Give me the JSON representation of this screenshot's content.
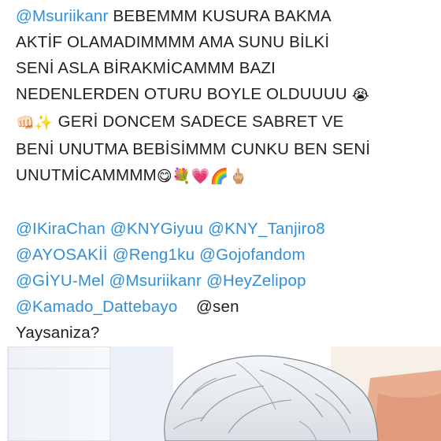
{
  "post": {
    "line1": {
      "mention": "@Msuriikanr",
      "text": " BEBEMMM KUSURA BAKMA"
    },
    "line2": "AKTİF OLAMADIMMMM AMA SUNU BİLKİ",
    "line3": "SENİ ASLA BİRAKMİCAMMM BAZI",
    "line4": {
      "text": "NEDENLERDEN OTURU BOYLE OLDUUUU ",
      "emoji": "😭"
    },
    "line5": {
      "emoji_a": "👊🏻",
      "emoji_b": "✨",
      "text": " GERİ DONCEM SADECE SABRET VE"
    },
    "line6": "BENİ UNUTMA BEBİSİMMM CUNKU BEN SENİ",
    "line7": {
      "text": "UNUTMİCAMMMM",
      "emojis": "😋💐💗🌈🖕🏼"
    },
    "mentions_line1": [
      "@IKiraChan",
      "@KNYGiyuu",
      "@KNY_Tanjiro8"
    ],
    "mentions_line2": [
      "@AYOSAKİİ",
      "@Reng1ku",
      "@Gojofandom"
    ],
    "mentions_line3": [
      "@GİYU-Mel",
      "@Msuriikanr",
      "@HeyZelipop"
    ],
    "mentions_line4": {
      "mention": "@Kamado_Dattebayo",
      "plain": "@sen"
    },
    "closing": "Yaysaniza?"
  },
  "colors": {
    "mention": "#2f8fd8",
    "text": "#1f1f1f"
  },
  "image": {
    "subject": "anime-character-white-hair"
  }
}
